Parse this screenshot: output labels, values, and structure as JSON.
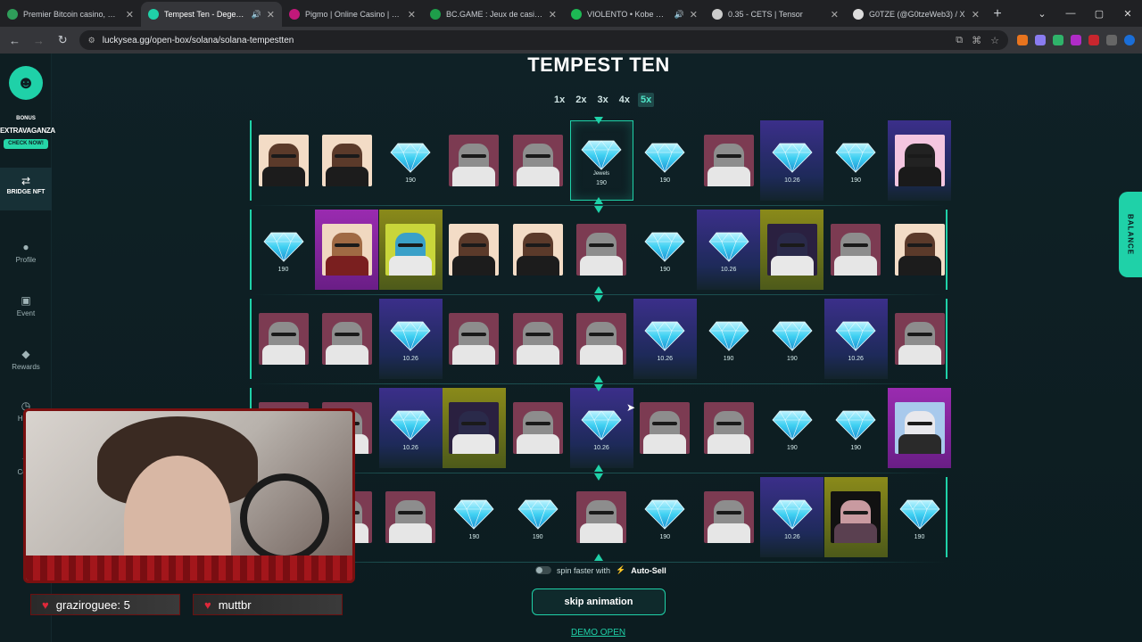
{
  "browser": {
    "tabs": [
      {
        "title": "Premier Bitcoin casino, Ethereu",
        "color": "#2f9e5a",
        "active": false,
        "audio": false
      },
      {
        "title": "Tempest Ten - Degenerate",
        "color": "#1fd1a8",
        "active": true,
        "audio": true
      },
      {
        "title": "Pigmo | Online Casino | Pigmo",
        "color": "#c2187a",
        "active": false,
        "audio": false
      },
      {
        "title": "BC.GAME : Jeux de casino cryp",
        "color": "#1e9e4a",
        "active": false,
        "audio": false
      },
      {
        "title": "VIOLENTO • Kobe Mane",
        "color": "#1db954",
        "active": false,
        "audio": true
      },
      {
        "title": "0.35 - CETS | Tensor",
        "color": "#cccccc",
        "active": false,
        "audio": false
      },
      {
        "title": "G0TZE (@G0tzeWeb3) / X",
        "color": "#dddddd",
        "active": false,
        "audio": false
      }
    ],
    "url": "luckysea.gg/open-box/solana/solana-tempestten"
  },
  "sidebar": {
    "bonus": "BONUS",
    "extravaganza": "EXTRAVAGANZA",
    "check_now": "CHECK NOW!",
    "bridge": "BRIDGE NFT",
    "items": [
      {
        "label": "Profile",
        "icon": "profile-icon"
      },
      {
        "label": "Event",
        "icon": "event-icon"
      },
      {
        "label": "Rewards",
        "icon": "rewards-icon"
      },
      {
        "label": "Histo",
        "icon": "history-icon"
      },
      {
        "label": "Coup",
        "icon": "coupon-icon"
      }
    ]
  },
  "balance_tab": "BALANCE",
  "game": {
    "title": "TEMPEST TEN",
    "multipliers": [
      "1x",
      "2x",
      "3x",
      "4x",
      "5x"
    ],
    "active_multiplier": "5x",
    "rows": [
      [
        {
          "kind": "nft",
          "style": "ape-dark"
        },
        {
          "kind": "nft",
          "style": "ape-dark"
        },
        {
          "kind": "gem",
          "value": "190"
        },
        {
          "kind": "nft",
          "style": "ape-gray"
        },
        {
          "kind": "nft",
          "style": "ape-gray"
        },
        {
          "kind": "gem",
          "value": "190",
          "label": "Jewels",
          "highlight": true
        },
        {
          "kind": "gem",
          "value": "190"
        },
        {
          "kind": "nft",
          "style": "ape-gray"
        },
        {
          "kind": "gem",
          "value": "10.26",
          "bg": "purple"
        },
        {
          "kind": "gem",
          "value": "190"
        },
        {
          "kind": "nft",
          "style": "ape-mask",
          "bg": "purple"
        }
      ],
      [
        {
          "kind": "gem",
          "value": "190"
        },
        {
          "kind": "nft",
          "style": "ape-hat",
          "bg": "magenta"
        },
        {
          "kind": "nft",
          "style": "ape-green",
          "bg": "olive"
        },
        {
          "kind": "nft",
          "style": "ape-dark"
        },
        {
          "kind": "nft",
          "style": "ape-dark"
        },
        {
          "kind": "nft",
          "style": "ape-gray"
        },
        {
          "kind": "gem",
          "value": "190"
        },
        {
          "kind": "gem",
          "value": "10.26",
          "bg": "purple"
        },
        {
          "kind": "nft",
          "style": "ape-penguin",
          "bg": "olive"
        },
        {
          "kind": "nft",
          "style": "ape-gray"
        },
        {
          "kind": "nft",
          "style": "ape-dark"
        }
      ],
      [
        {
          "kind": "nft",
          "style": "ape-gray"
        },
        {
          "kind": "nft",
          "style": "ape-gray"
        },
        {
          "kind": "gem",
          "value": "10.26",
          "bg": "purple"
        },
        {
          "kind": "nft",
          "style": "ape-gray"
        },
        {
          "kind": "nft",
          "style": "ape-gray"
        },
        {
          "kind": "nft",
          "style": "ape-gray"
        },
        {
          "kind": "gem",
          "value": "10.26",
          "bg": "purple"
        },
        {
          "kind": "gem",
          "value": "190"
        },
        {
          "kind": "gem",
          "value": "190"
        },
        {
          "kind": "gem",
          "value": "10.26",
          "bg": "purple"
        },
        {
          "kind": "nft",
          "style": "ape-gray"
        }
      ],
      [
        {
          "kind": "nft",
          "style": "ape-gray"
        },
        {
          "kind": "nft",
          "style": "ape-gray"
        },
        {
          "kind": "gem",
          "value": "10.26",
          "bg": "purple"
        },
        {
          "kind": "nft",
          "style": "ape-penguin",
          "bg": "olive"
        },
        {
          "kind": "nft",
          "style": "ape-gray"
        },
        {
          "kind": "gem",
          "value": "10.26",
          "bg": "purple"
        },
        {
          "kind": "nft",
          "style": "ape-gray"
        },
        {
          "kind": "nft",
          "style": "ape-gray"
        },
        {
          "kind": "gem",
          "value": "190"
        },
        {
          "kind": "gem",
          "value": "190"
        },
        {
          "kind": "nft",
          "style": "ape-blue",
          "bg": "magenta"
        }
      ],
      [
        {
          "kind": "nft",
          "style": "ape-gray"
        },
        {
          "kind": "nft",
          "style": "ape-gray"
        },
        {
          "kind": "nft",
          "style": "ape-gray"
        },
        {
          "kind": "gem",
          "value": "190"
        },
        {
          "kind": "gem",
          "value": "190"
        },
        {
          "kind": "nft",
          "style": "ape-gray"
        },
        {
          "kind": "gem",
          "value": "190"
        },
        {
          "kind": "nft",
          "style": "ape-gray"
        },
        {
          "kind": "gem",
          "value": "10.26",
          "bg": "purple"
        },
        {
          "kind": "nft",
          "style": "fig",
          "bg": "olive"
        },
        {
          "kind": "gem",
          "value": "190"
        }
      ]
    ],
    "spin_faster_prefix": "spin faster with",
    "auto_sell": "Auto-Sell",
    "skip_button": "skip animation",
    "demo_link": "DEMO OPEN"
  },
  "stream": {
    "label_left": "graziroguee: 5",
    "label_right": "muttbr"
  },
  "colors": {
    "accent": "#1fd1a8",
    "background": "#0c1a1e",
    "gem": "#3fd0f2"
  }
}
